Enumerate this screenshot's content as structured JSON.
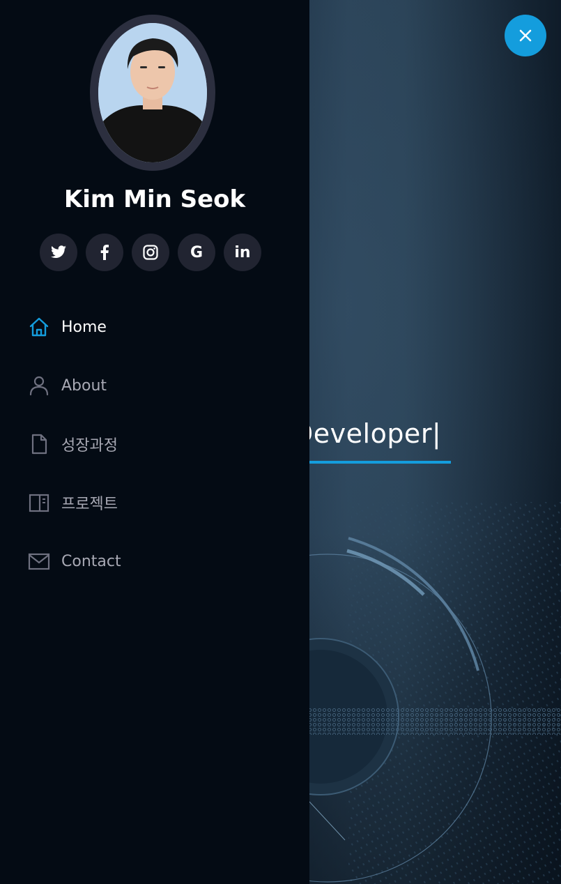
{
  "profile": {
    "name": "Kim Min Seok"
  },
  "socials": [
    {
      "icon": "twitter-icon"
    },
    {
      "icon": "facebook-icon"
    },
    {
      "icon": "instagram-icon"
    },
    {
      "icon": "google-icon",
      "glyph": "G"
    },
    {
      "icon": "linkedin-icon",
      "glyph": "in"
    }
  ],
  "nav": {
    "items": [
      {
        "label": "Home",
        "icon": "home-icon",
        "active": true
      },
      {
        "label": "About",
        "icon": "person-icon",
        "active": false
      },
      {
        "label": "성장과정",
        "icon": "file-icon",
        "active": false
      },
      {
        "label": "프로젝트",
        "icon": "book-icon",
        "active": false
      },
      {
        "label": "Contact",
        "icon": "envelope-icon",
        "active": false
      }
    ]
  },
  "hero": {
    "typed_text": "Developer|"
  },
  "colors": {
    "accent": "#149ddd",
    "sidebar_bg": "#040b14",
    "social_bg": "#212431",
    "nav_text": "#a8a9b4"
  }
}
